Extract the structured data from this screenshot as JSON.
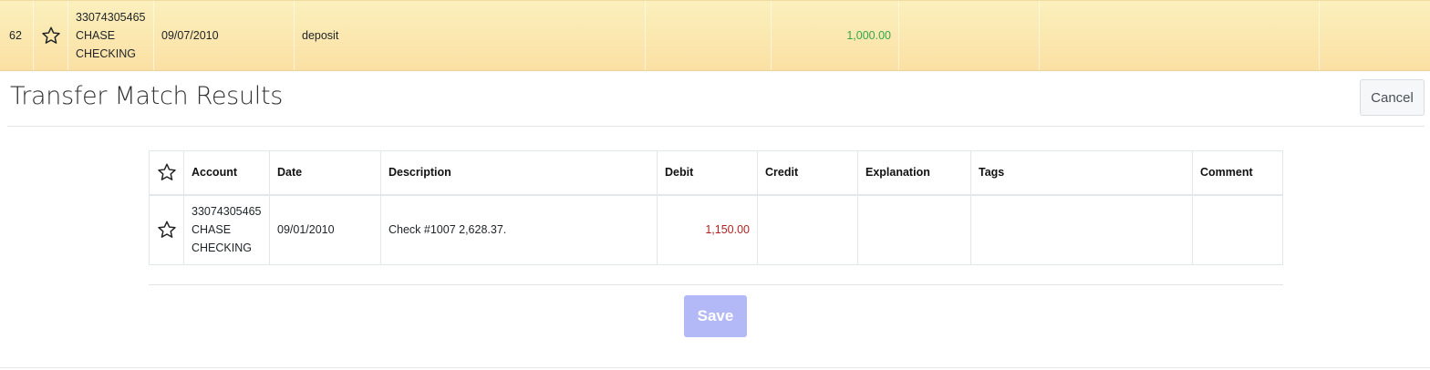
{
  "top_row": {
    "number": "62",
    "account_lines": [
      "33074305465",
      "CHASE",
      "CHECKING"
    ],
    "date": "09/07/2010",
    "description": "deposit",
    "credit": "1,000.00",
    "credit_color": "#2fa84f"
  },
  "header": {
    "title": "Transfer Match Results",
    "cancel_label": "Cancel"
  },
  "table": {
    "columns": [
      "Account",
      "Date",
      "Description",
      "Debit",
      "Credit",
      "Explanation",
      "Tags",
      "Comment"
    ],
    "rows": [
      {
        "account_lines": [
          "33074305465",
          "CHASE",
          "CHECKING"
        ],
        "date": "09/01/2010",
        "description": "Check #1007 2,628.37.",
        "debit": "1,150.00",
        "credit": "",
        "explanation": "",
        "tags": "",
        "comment": ""
      }
    ]
  },
  "footer": {
    "save_label": "Save",
    "save_color": "#b3b8f7"
  },
  "icons": [
    "star-outline-icon"
  ],
  "colors": {
    "row_highlight": "#fbe6ad",
    "debit": "#b22222"
  }
}
